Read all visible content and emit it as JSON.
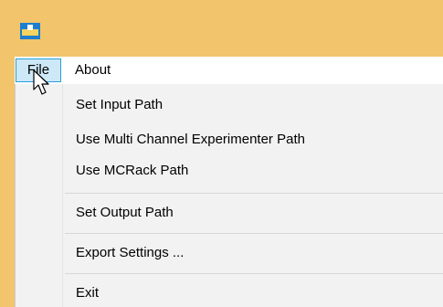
{
  "menubar": {
    "file_label": "File",
    "about_label": "About"
  },
  "file_menu": {
    "items": [
      {
        "label": "Set Input Path"
      },
      {
        "label": "Use Multi Channel Experimenter Path"
      },
      {
        "label": "Use MCRack Path"
      },
      {
        "label": "Set Output Path"
      },
      {
        "label": "Export Settings ..."
      },
      {
        "label": "Exit"
      }
    ]
  },
  "colors": {
    "window_border": "#f2c46b",
    "menu_highlight": "#cde8f7",
    "menu_highlight_border": "#26a0da",
    "dropdown_bg": "#f2f2f2"
  },
  "icons": {
    "app": "app-icon",
    "cursor": "mouse-cursor-icon"
  }
}
